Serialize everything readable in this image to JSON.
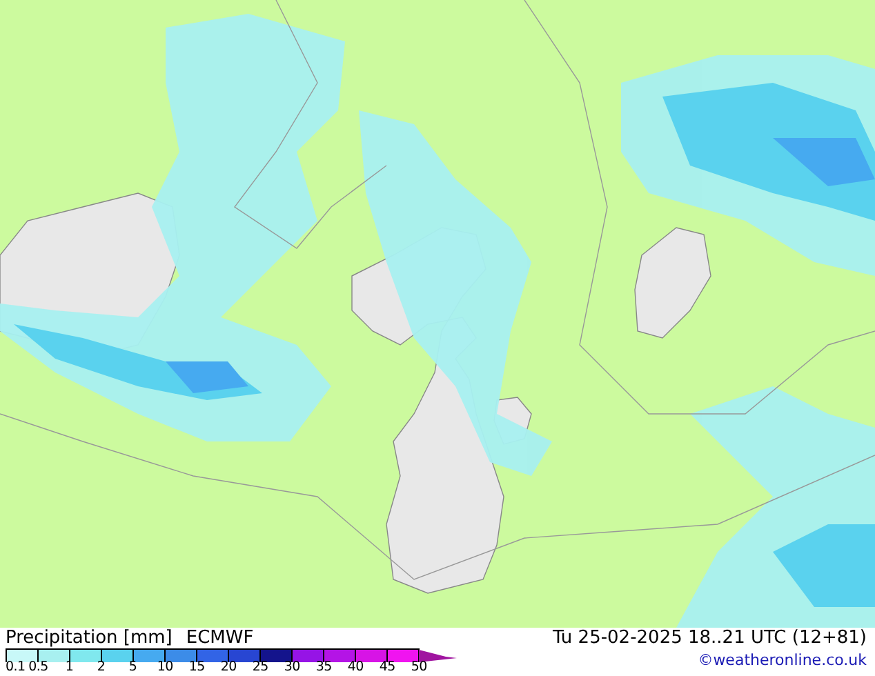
{
  "title": "Precipitation [mm]",
  "model": "ECMWF",
  "valid_time": "Tu 25-02-2025 18..21 UTC (12+81)",
  "credit": "©weatheronline.co.uk",
  "legend": {
    "labels": [
      "0.1",
      "0.5",
      "1",
      "2",
      "5",
      "10",
      "15",
      "20",
      "25",
      "30",
      "35",
      "40",
      "45",
      "50"
    ],
    "swatches": [
      {
        "color": "#c8f8f8"
      },
      {
        "color": "#a8f0f0"
      },
      {
        "color": "#80e8ee"
      },
      {
        "color": "#5ad2ee"
      },
      {
        "color": "#46aaf0"
      },
      {
        "color": "#3c8ce8"
      },
      {
        "color": "#3264e6"
      },
      {
        "color": "#2846d2"
      },
      {
        "color": "#14148c"
      },
      {
        "color": "#9614e6"
      },
      {
        "color": "#b414e6"
      },
      {
        "color": "#d714e6"
      },
      {
        "color": "#f014f0"
      },
      {
        "color": "#a014a0",
        "kind": "arrow"
      }
    ]
  }
}
